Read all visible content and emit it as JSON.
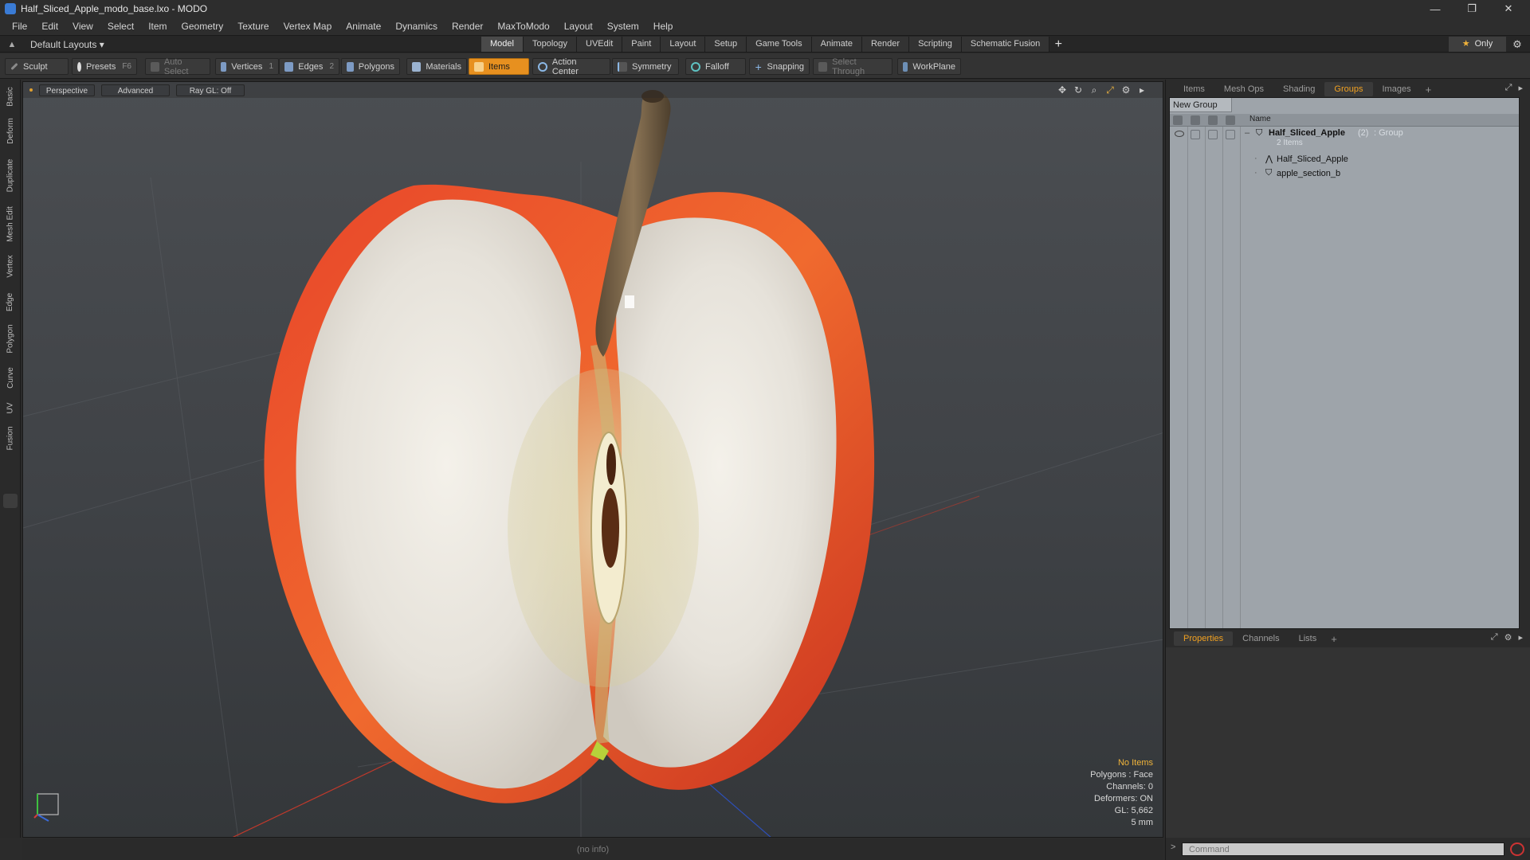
{
  "window": {
    "title": "Half_Sliced_Apple_modo_base.lxo - MODO",
    "minimize": "—",
    "restore": "❐",
    "close": "✕"
  },
  "menu": [
    "File",
    "Edit",
    "View",
    "Select",
    "Item",
    "Geometry",
    "Texture",
    "Vertex Map",
    "Animate",
    "Dynamics",
    "Render",
    "MaxToModo",
    "Layout",
    "System",
    "Help"
  ],
  "layout_bar": {
    "layout_select": "Default Layouts ▾",
    "tabs": [
      "Model",
      "Topology",
      "UVEdit",
      "Paint",
      "Layout",
      "Setup",
      "Game Tools",
      "Animate",
      "Render",
      "Scripting",
      "Schematic Fusion"
    ],
    "active_tab": "Model",
    "add_tab": "+",
    "only_label": "Only",
    "star_glyph": "★"
  },
  "toolbar": {
    "sculpt": "Sculpt",
    "presets": "Presets",
    "presets_key": "F6",
    "auto_select": "Auto Select",
    "vertices": "Vertices",
    "vertices_num": "1",
    "edges": "Edges",
    "edges_num": "2",
    "polygons": "Polygons",
    "materials": "Materials",
    "items": "Items",
    "action_center": "Action Center",
    "symmetry": "Symmetry",
    "falloff": "Falloff",
    "snapping": "Snapping",
    "select_through": "Select Through",
    "workplane": "WorkPlane"
  },
  "left_tabs": [
    "Basic",
    "Deform",
    "Duplicate",
    "Mesh Edit",
    "Vertex",
    "Edge",
    "Polygon",
    "Curve",
    "UV",
    "Fusion"
  ],
  "viewport": {
    "view_mode": "Perspective",
    "shading": "Advanced",
    "raygl": "Ray GL: Off",
    "hud": {
      "selection": "No Items",
      "polygons": "Polygons : Face",
      "channels": "Channels: 0",
      "deformers": "Deformers: ON",
      "gl": "GL: 5,662",
      "unit": "5 mm"
    }
  },
  "status_bar": {
    "info": "(no info)"
  },
  "right_panel": {
    "top_tabs": [
      "Items",
      "Mesh Ops",
      "Shading",
      "Groups",
      "Images"
    ],
    "active_top_tab": "Groups",
    "add_tab": "+",
    "new_group": "New Group",
    "name_header": "Name",
    "group": {
      "name": "Half_Sliced_Apple",
      "count": "(2)",
      "type": ": Group",
      "subtitle": "2 Items",
      "children": [
        "Half_Sliced_Apple",
        "apple_section_b"
      ]
    },
    "bottom_tabs": [
      "Properties",
      "Channels",
      "Lists"
    ],
    "active_bottom_tab": "Properties",
    "command_placeholder": "Command",
    "command_prompt": ">"
  },
  "colors": {
    "accent": "#e7901f",
    "viewport_bg": "#45484c",
    "groups_bg": "#9ea4aa"
  }
}
